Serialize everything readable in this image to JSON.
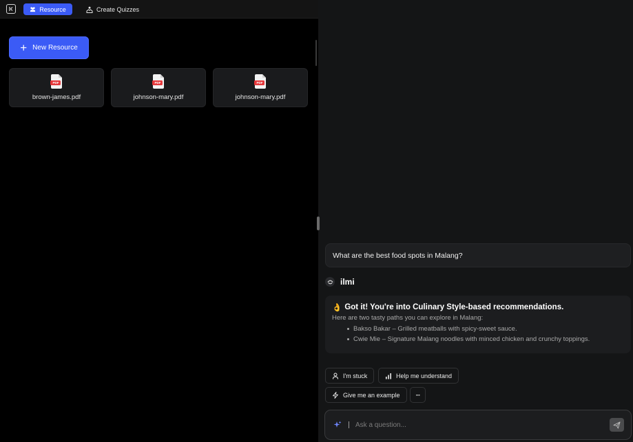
{
  "topbar": {
    "tabs": [
      {
        "label": "Resource",
        "icon": "users-icon",
        "active": true
      },
      {
        "label": "Create Quizzes",
        "icon": "quiz-icon",
        "active": false
      }
    ]
  },
  "resources": {
    "new_button_label": "New Resource",
    "files": [
      {
        "name": "brown-james.pdf",
        "badge": "PDF"
      },
      {
        "name": "johnson-mary.pdf",
        "badge": "PDF"
      },
      {
        "name": "johnson-mary.pdf",
        "badge": "PDF"
      }
    ]
  },
  "chat": {
    "user_message": "What are the best food spots in Malang?",
    "bot_name": "ilmi",
    "bot_reply": {
      "emoji": "👌",
      "title": "Got it! You're into Culinary Style-based recommendations.",
      "subtitle": "Here are two tasty paths you can explore in Malang:",
      "items": [
        "Bakso Bakar – Grilled meatballs with spicy-sweet sauce.",
        "Cwie Mie – Signature Malang noodles with minced chicken and crunchy toppings."
      ]
    },
    "quick_actions": [
      {
        "label": "I'm stuck",
        "icon": "person-icon"
      },
      {
        "label": "Help me understand",
        "icon": "bar-chart-icon"
      },
      {
        "label": "Give me an example",
        "icon": "lightning-icon"
      },
      {
        "label": "···",
        "icon": "more-icon"
      }
    ],
    "input": {
      "placeholder": "Ask a question..."
    }
  },
  "colors": {
    "accent": "#3b5bf6",
    "pdf_red": "#e5383b",
    "panel_bg": "#141516"
  }
}
